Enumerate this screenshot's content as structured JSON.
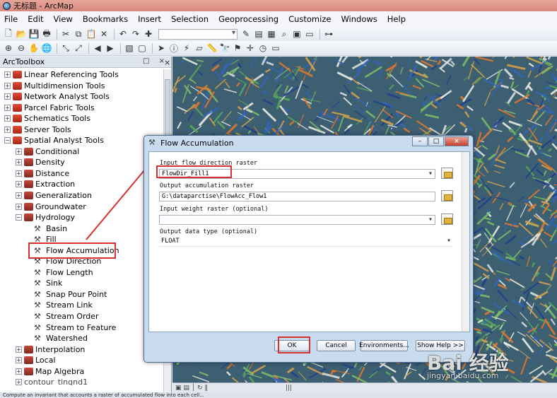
{
  "window": {
    "title": "无标题 - ArcMap"
  },
  "menu": [
    "File",
    "Edit",
    "View",
    "Bookmarks",
    "Insert",
    "Selection",
    "Geoprocessing",
    "Customize",
    "Windows",
    "Help"
  ],
  "arctoolbox": {
    "title": "ArcToolbox",
    "controls": "□ ×",
    "close": "×",
    "toolboxes": [
      {
        "label": "Linear Referencing Tools",
        "pm": "+"
      },
      {
        "label": "Multidimension Tools",
        "pm": "+"
      },
      {
        "label": "Network Analyst Tools",
        "pm": "+"
      },
      {
        "label": "Parcel Fabric Tools",
        "pm": "+"
      },
      {
        "label": "Schematics Tools",
        "pm": "+"
      },
      {
        "label": "Server Tools",
        "pm": "+"
      },
      {
        "label": "Spatial Analyst Tools",
        "pm": "−"
      }
    ],
    "toolsets": [
      {
        "label": "Conditional",
        "pm": "+"
      },
      {
        "label": "Density",
        "pm": "+"
      },
      {
        "label": "Distance",
        "pm": "+"
      },
      {
        "label": "Extraction",
        "pm": "+"
      },
      {
        "label": "Generalization",
        "pm": "+"
      },
      {
        "label": "Groundwater",
        "pm": "+"
      },
      {
        "label": "Hydrology",
        "pm": "−"
      }
    ],
    "hydrology_tools": [
      "Basin",
      "Fill",
      "Flow Accumulation",
      "Flow Direction",
      "Flow Length",
      "Sink",
      "Snap Pour Point",
      "Stream Link",
      "Stream Order",
      "Stream to Feature",
      "Watershed"
    ],
    "toolsets_after": [
      {
        "label": "Interpolation",
        "pm": "+"
      },
      {
        "label": "Local",
        "pm": "+"
      },
      {
        "label": "Map Algebra",
        "pm": "+"
      }
    ],
    "cut_item": "contour_tingnd1"
  },
  "dialog": {
    "title": "Flow Accumulation",
    "win_controls": {
      "min": "–",
      "max": "□",
      "close": "×"
    },
    "params": {
      "in_label": "Input flow direction raster",
      "in_value": "FlowDir_Fill1",
      "out_label": "Output accumulation raster",
      "out_value": "G:\\dataparctise\\FlowAcc_Flow1",
      "weight_label": "Input weight raster (optional)",
      "weight_value": "",
      "type_label": "Output data type (optional)",
      "type_value": "FLOAT"
    },
    "buttons": {
      "ok": "OK",
      "cancel": "Cancel",
      "environments": "Environments...",
      "showhelp": "Show Help >>"
    }
  },
  "map_status": "▣ ▤ │ ↻ ‖",
  "map_scroll": "|||",
  "statusbar": "Compute an invariant that accounts a raster of accumulated flow into each cell...",
  "watermark": {
    "text": "Bai 经验",
    "sub": "jingyan.baidu.com"
  },
  "colors": {
    "highlight": "#d63131",
    "dialog_frame": "#c9dcef",
    "map_orange": "#e6782b",
    "map_blue": "#2f67c7",
    "map_green": "#59a85a"
  }
}
